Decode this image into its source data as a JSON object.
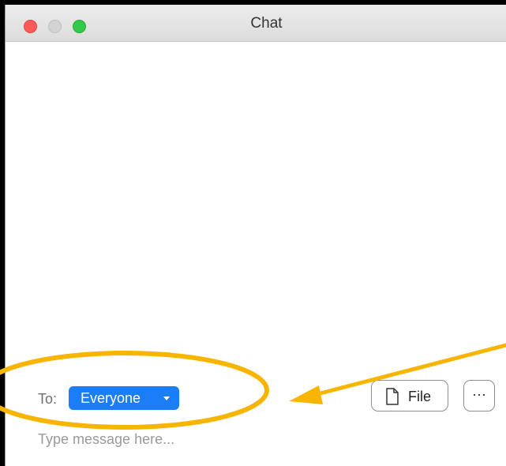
{
  "window": {
    "title": "Chat"
  },
  "composer": {
    "to_label": "To:",
    "recipient": "Everyone",
    "file_label": "File",
    "more_label": "···",
    "placeholder": "Type message here..."
  },
  "colors": {
    "accent": "#1c7ef6",
    "annotation": "#f7b500",
    "close": "#fc5b57",
    "zoom": "#34c84a"
  },
  "icons": {
    "file": "document-icon",
    "more": "ellipsis-icon",
    "recipient_dropdown": "caret-down-icon"
  }
}
